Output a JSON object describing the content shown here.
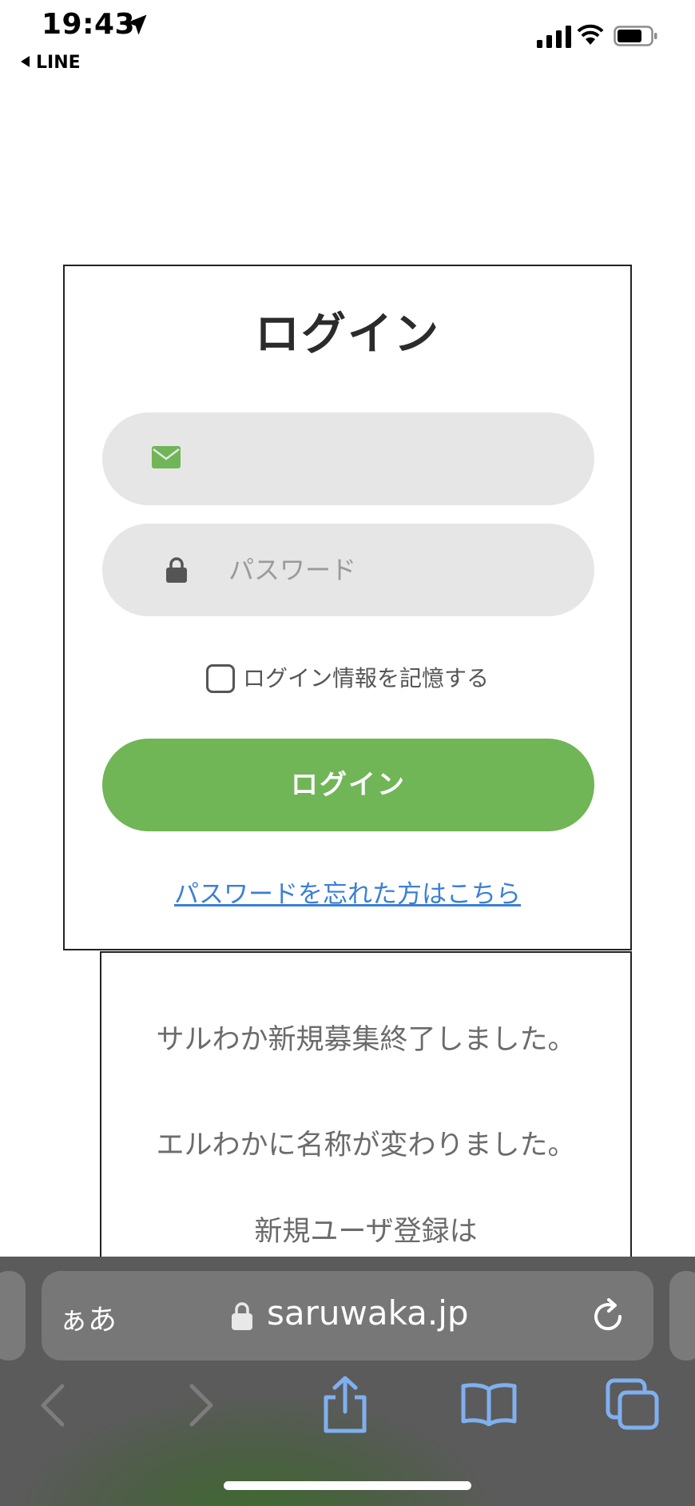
{
  "status_bar": {
    "time": "19:43",
    "back_app": "LINE",
    "icons": [
      "location-arrow-icon",
      "signal-icon",
      "wifi-icon",
      "battery-icon"
    ]
  },
  "login": {
    "title": "ログイン",
    "email_placeholder": "",
    "password_placeholder": "パスワード",
    "remember_label": "ログイン情報を記憶する",
    "button_label": "ログイン",
    "forgot_link": "パスワードを忘れた方はこちら"
  },
  "notice": {
    "lines": [
      "サルわか新規募集終了しました。",
      "エルわかに名称が変わりました。",
      "新規ユーザ登録は"
    ]
  },
  "browser": {
    "text_size_button": "ぁあ",
    "url": "saruwaka.jp"
  },
  "colors": {
    "accent_green": "#70b556",
    "link_blue": "#3b7fd6",
    "field_bg": "#e6e6e6",
    "toolbar_icon_blue": "#7fb0f0"
  }
}
